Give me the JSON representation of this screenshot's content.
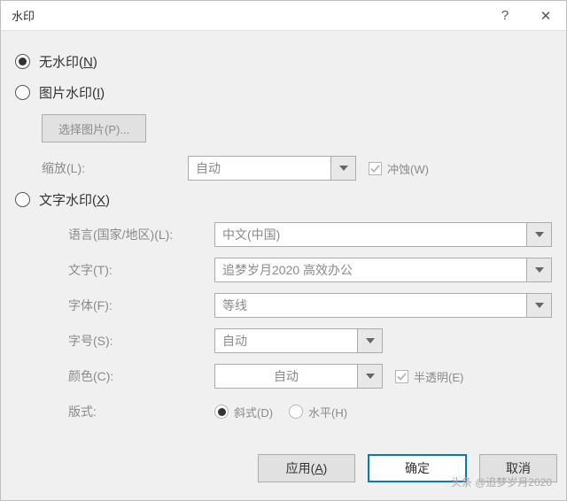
{
  "titlebar": {
    "title": "水印",
    "help": "?",
    "close": "✕"
  },
  "options": {
    "none": {
      "label": "无水印(",
      "key": "N",
      "tail": ")"
    },
    "picture": {
      "label": "图片水印(",
      "key": "I",
      "tail": ")"
    },
    "text": {
      "label": "文字水印(",
      "key": "X",
      "tail": ")"
    }
  },
  "picture_section": {
    "select_btn": "选择图片(P)...",
    "scale_label": "缩放(L):",
    "scale_value": "自动",
    "washout_label": "冲蚀(W)"
  },
  "text_section": {
    "lang_label": "语言(国家/地区)(L):",
    "lang_value": "中文(中国)",
    "text_label": "文字(T):",
    "text_value": "追梦岁月2020  高效办公",
    "font_label": "字体(F):",
    "font_value": "等线",
    "size_label": "字号(S):",
    "size_value": "自动",
    "color_label": "颜色(C):",
    "color_value": "自动",
    "semitrans_label": "半透明(E)",
    "layout_label": "版式:",
    "diag_label": "斜式(D)",
    "horiz_label": "水平(H)"
  },
  "buttons": {
    "apply": "应用(",
    "apply_key": "A",
    "apply_tail": ")",
    "ok": "确定",
    "cancel": "取消"
  },
  "source_watermark": "头条 @追梦岁月2020"
}
